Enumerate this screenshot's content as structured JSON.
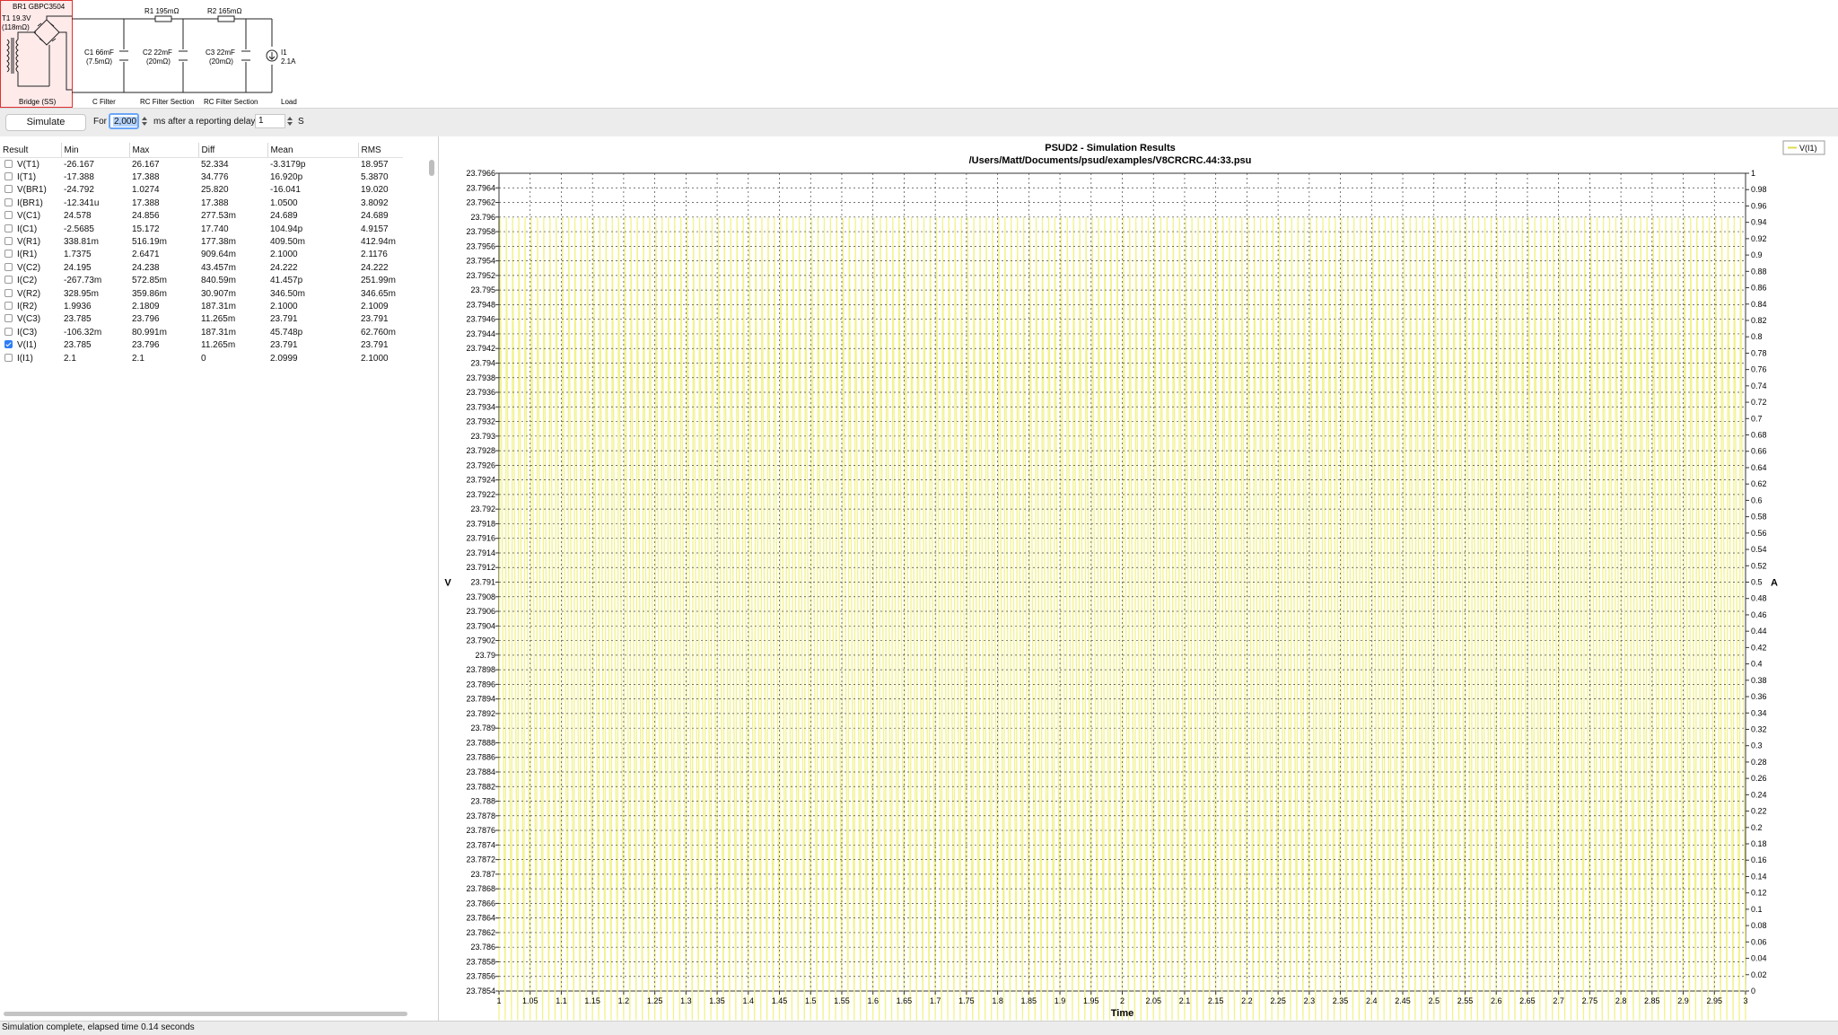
{
  "circuit": {
    "bridge_title": "BR1 GBPC3504",
    "transformer": [
      "T1 19.3V",
      "(118mΩ)"
    ],
    "r1": "R1 195mΩ",
    "r2": "R2 165mΩ",
    "c1": [
      "C1 66mF",
      "(7.5mΩ)"
    ],
    "c2": [
      "C2 22mF",
      "(20mΩ)"
    ],
    "c3": [
      "C3 22mF",
      "(20mΩ)"
    ],
    "load": [
      "I1",
      "2.1A"
    ],
    "sections": [
      "Bridge (SS)",
      "C Filter",
      "RC Filter Section",
      "RC Filter Section",
      "Load"
    ]
  },
  "controls": {
    "simulate_label": "Simulate",
    "for_label": "For",
    "duration_value": "2,000",
    "delay_text": "ms after a reporting delay",
    "delay_value": "1",
    "unit_label": "S"
  },
  "results": {
    "headers": [
      "Result",
      "Min",
      "Max",
      "Diff",
      "Mean",
      "RMS"
    ],
    "rows": [
      {
        "name": "V(T1)",
        "min": "-26.167",
        "max": "26.167",
        "diff": "52.334",
        "mean": "-3.3179p",
        "rms": "18.957",
        "checked": false
      },
      {
        "name": "I(T1)",
        "min": "-17.388",
        "max": "17.388",
        "diff": "34.776",
        "mean": "16.920p",
        "rms": "5.3870",
        "checked": false
      },
      {
        "name": "V(BR1)",
        "min": "-24.792",
        "max": "1.0274",
        "diff": "25.820",
        "mean": "-16.041",
        "rms": "19.020",
        "checked": false
      },
      {
        "name": "I(BR1)",
        "min": "-12.341u",
        "max": "17.388",
        "diff": "17.388",
        "mean": "1.0500",
        "rms": "3.8092",
        "checked": false
      },
      {
        "name": "V(C1)",
        "min": "24.578",
        "max": "24.856",
        "diff": "277.53m",
        "mean": "24.689",
        "rms": "24.689",
        "checked": false
      },
      {
        "name": "I(C1)",
        "min": "-2.5685",
        "max": "15.172",
        "diff": "17.740",
        "mean": "104.94p",
        "rms": "4.9157",
        "checked": false
      },
      {
        "name": "V(R1)",
        "min": "338.81m",
        "max": "516.19m",
        "diff": "177.38m",
        "mean": "409.50m",
        "rms": "412.94m",
        "checked": false
      },
      {
        "name": "I(R1)",
        "min": "1.7375",
        "max": "2.6471",
        "diff": "909.64m",
        "mean": "2.1000",
        "rms": "2.1176",
        "checked": false
      },
      {
        "name": "V(C2)",
        "min": "24.195",
        "max": "24.238",
        "diff": "43.457m",
        "mean": "24.222",
        "rms": "24.222",
        "checked": false
      },
      {
        "name": "I(C2)",
        "min": "-267.73m",
        "max": "572.85m",
        "diff": "840.59m",
        "mean": "41.457p",
        "rms": "251.99m",
        "checked": false
      },
      {
        "name": "V(R2)",
        "min": "328.95m",
        "max": "359.86m",
        "diff": "30.907m",
        "mean": "346.50m",
        "rms": "346.65m",
        "checked": false
      },
      {
        "name": "I(R2)",
        "min": "1.9936",
        "max": "2.1809",
        "diff": "187.31m",
        "mean": "2.1000",
        "rms": "2.1009",
        "checked": false
      },
      {
        "name": "V(C3)",
        "min": "23.785",
        "max": "23.796",
        "diff": "11.265m",
        "mean": "23.791",
        "rms": "23.791",
        "checked": false
      },
      {
        "name": "I(C3)",
        "min": "-106.32m",
        "max": "80.991m",
        "diff": "187.31m",
        "mean": "45.748p",
        "rms": "62.760m",
        "checked": false
      },
      {
        "name": "V(I1)",
        "min": "23.785",
        "max": "23.796",
        "diff": "11.265m",
        "mean": "23.791",
        "rms": "23.791",
        "checked": true
      },
      {
        "name": "I(I1)",
        "min": "2.1",
        "max": "2.1",
        "diff": "0",
        "mean": "2.0999",
        "rms": "2.1000",
        "checked": false
      }
    ]
  },
  "chart": {
    "title": "PSUD2 - Simulation Results",
    "subtitle": "/Users/Matt/Documents/psud/examples/V8CRCRC.44:33.psu",
    "legend_label": "V(I1)"
  },
  "chart_data": {
    "type": "line",
    "title": "PSUD2 - Simulation Results",
    "subtitle": "/Users/Matt/Documents/psud/examples/V8CRCRC.44:33.psu",
    "xlabel": "Time",
    "ylabel": "V",
    "y2label": "A",
    "xlim": [
      1,
      3
    ],
    "ylim": [
      23.7854,
      23.7966
    ],
    "y2lim": [
      0,
      1
    ],
    "x_ticks": [
      "1",
      "1.05",
      "1.1",
      "1.15",
      "1.2",
      "1.25",
      "1.3",
      "1.35",
      "1.4",
      "1.45",
      "1.5",
      "1.55",
      "1.6",
      "1.65",
      "1.7",
      "1.75",
      "1.8",
      "1.85",
      "1.9",
      "1.95",
      "2",
      "2.05",
      "2.1",
      "2.15",
      "2.2",
      "2.25",
      "2.3",
      "2.35",
      "2.4",
      "2.45",
      "2.5",
      "2.55",
      "2.6",
      "2.65",
      "2.7",
      "2.75",
      "2.8",
      "2.85",
      "2.9",
      "2.95",
      "3"
    ],
    "y_ticks": [
      "23.7966",
      "23.7964",
      "23.7962",
      "23.796",
      "23.7958",
      "23.7956",
      "23.7954",
      "23.7952",
      "23.795",
      "23.7948",
      "23.7946",
      "23.7944",
      "23.7942",
      "23.794",
      "23.7938",
      "23.7936",
      "23.7934",
      "23.7932",
      "23.793",
      "23.7928",
      "23.7926",
      "23.7924",
      "23.7922",
      "23.792",
      "23.7918",
      "23.7916",
      "23.7914",
      "23.7912",
      "23.791",
      "23.7908",
      "23.7906",
      "23.7904",
      "23.7902",
      "23.79",
      "23.7898",
      "23.7896",
      "23.7894",
      "23.7892",
      "23.789",
      "23.7888",
      "23.7886",
      "23.7884",
      "23.7882",
      "23.788",
      "23.7878",
      "23.7876",
      "23.7874",
      "23.7872",
      "23.787",
      "23.7868",
      "23.7866",
      "23.7864",
      "23.7862",
      "23.786",
      "23.7858",
      "23.7856",
      "23.7854"
    ],
    "y2_ticks": [
      "1",
      "0.98",
      "0.96",
      "0.94",
      "0.92",
      "0.9",
      "0.88",
      "0.86",
      "0.84",
      "0.82",
      "0.8",
      "0.78",
      "0.76",
      "0.74",
      "0.72",
      "0.7",
      "0.68",
      "0.66",
      "0.64",
      "0.62",
      "0.6",
      "0.58",
      "0.56",
      "0.54",
      "0.52",
      "0.5",
      "0.48",
      "0.46",
      "0.44",
      "0.42",
      "0.4",
      "0.38",
      "0.36",
      "0.34",
      "0.32",
      "0.3",
      "0.28",
      "0.26",
      "0.24",
      "0.22",
      "0.2",
      "0.18",
      "0.16",
      "0.14",
      "0.12",
      "0.1",
      "0.08",
      "0.06",
      "0.04",
      "0.02",
      "0"
    ],
    "grid": true,
    "legend": "top-right",
    "series": [
      {
        "name": "V(I1)",
        "color": "#f2f28c",
        "ripple_hz": 100,
        "min": 23.785,
        "max": 23.796
      }
    ]
  },
  "status": {
    "text": "Simulation complete, elapsed time 0.14 seconds"
  },
  "colors": {
    "trace": "#f2f28c",
    "selection": "#e03030",
    "accent": "#2f7cf6"
  }
}
